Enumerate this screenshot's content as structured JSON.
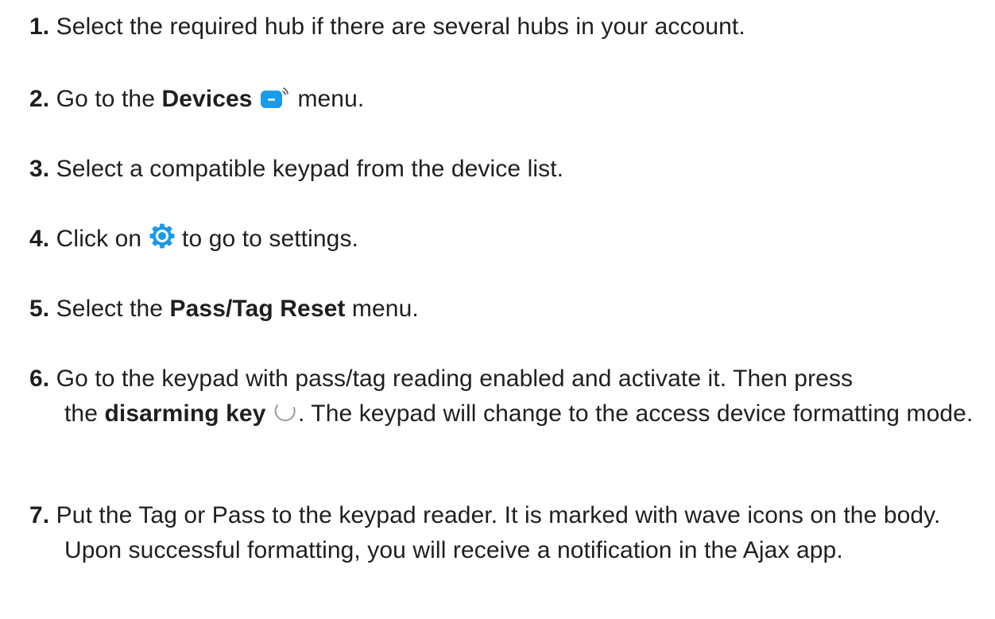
{
  "steps": [
    {
      "number": "1.",
      "text": "Select the required hub if there are several hubs in your account."
    },
    {
      "number": "2.",
      "text_before": "Go to the",
      "bold": "Devices",
      "icon": "devices-icon",
      "text_after": "menu."
    },
    {
      "number": "3.",
      "text": "Select a compatible keypad from the device list."
    },
    {
      "number": "4.",
      "text_before": "Click on",
      "icon": "gear-icon",
      "text_after": "to go to settings."
    },
    {
      "number": "5.",
      "text_before": "Select the",
      "bold": "Pass/Tag Reset",
      "text_after": "menu."
    },
    {
      "number": "6.",
      "line1": "Go to the keypad with pass/tag reading enabled and activate it. Then press",
      "text_before": "the",
      "bold": "disarming key",
      "icon": "disarm-key-icon",
      "text_after": ". The keypad will change to the access device formatting mode."
    },
    {
      "number": "7.",
      "text": "Put the Tag or Pass to the keypad reader. It is marked with wave icons on the body. Upon successful formatting, you will receive a notification in the Ajax app."
    }
  ],
  "colors": {
    "text": "#1f1f1f",
    "accent": "#1a9be8"
  }
}
